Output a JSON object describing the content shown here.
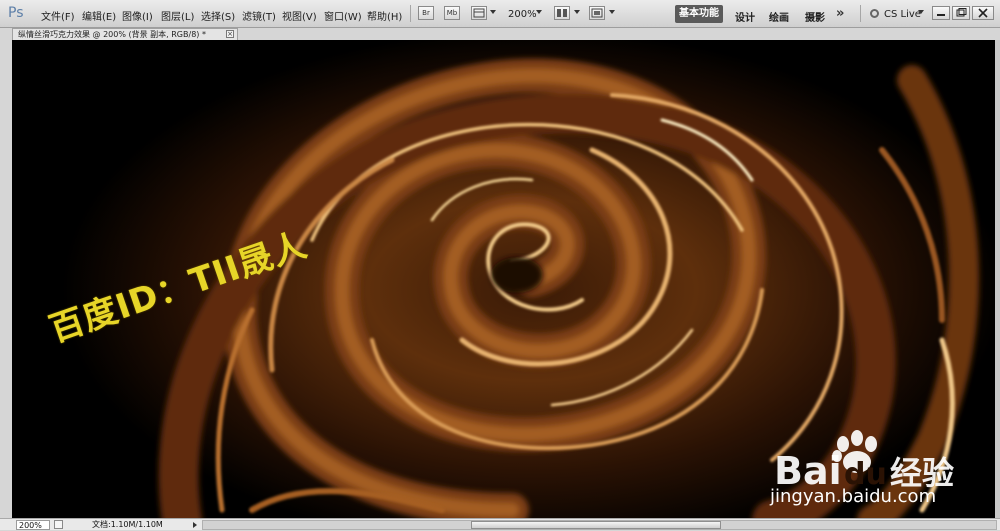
{
  "app": {
    "logo": "Ps"
  },
  "menu": {
    "items": [
      "文件(F)",
      "编辑(E)",
      "图像(I)",
      "图层(L)",
      "选择(S)",
      "滤镜(T)",
      "视图(V)",
      "窗口(W)",
      "帮助(H)"
    ]
  },
  "toolbar": {
    "bridge_label": "Br",
    "minibridge_label": "Mb",
    "zoom_value": "200%"
  },
  "workspace": {
    "active": "基本功能",
    "design": "设计",
    "painting": "绘画",
    "photography": "摄影",
    "more": "»",
    "cs_live": "CS Live"
  },
  "document": {
    "title": "纵情丝滑巧克力效果 @ 200% (背景 副本, RGB/8) *",
    "close_label": "×"
  },
  "canvas": {
    "overlay_text": "百度ID：TII晟人",
    "overlay_color": "#e7d528",
    "watermark_brand": "Bai",
    "watermark_brand_du": "du",
    "watermark_brand_cn": "经验",
    "watermark_site": "jingyan.baidu.com"
  },
  "status": {
    "zoom": "200%",
    "doc_info": "文档:1.10M/1.10M"
  },
  "colors": {
    "chocolate_dark": "#2a1204",
    "chocolate_mid": "#8a4a16",
    "chocolate_highlight": "#f3cb8a"
  }
}
